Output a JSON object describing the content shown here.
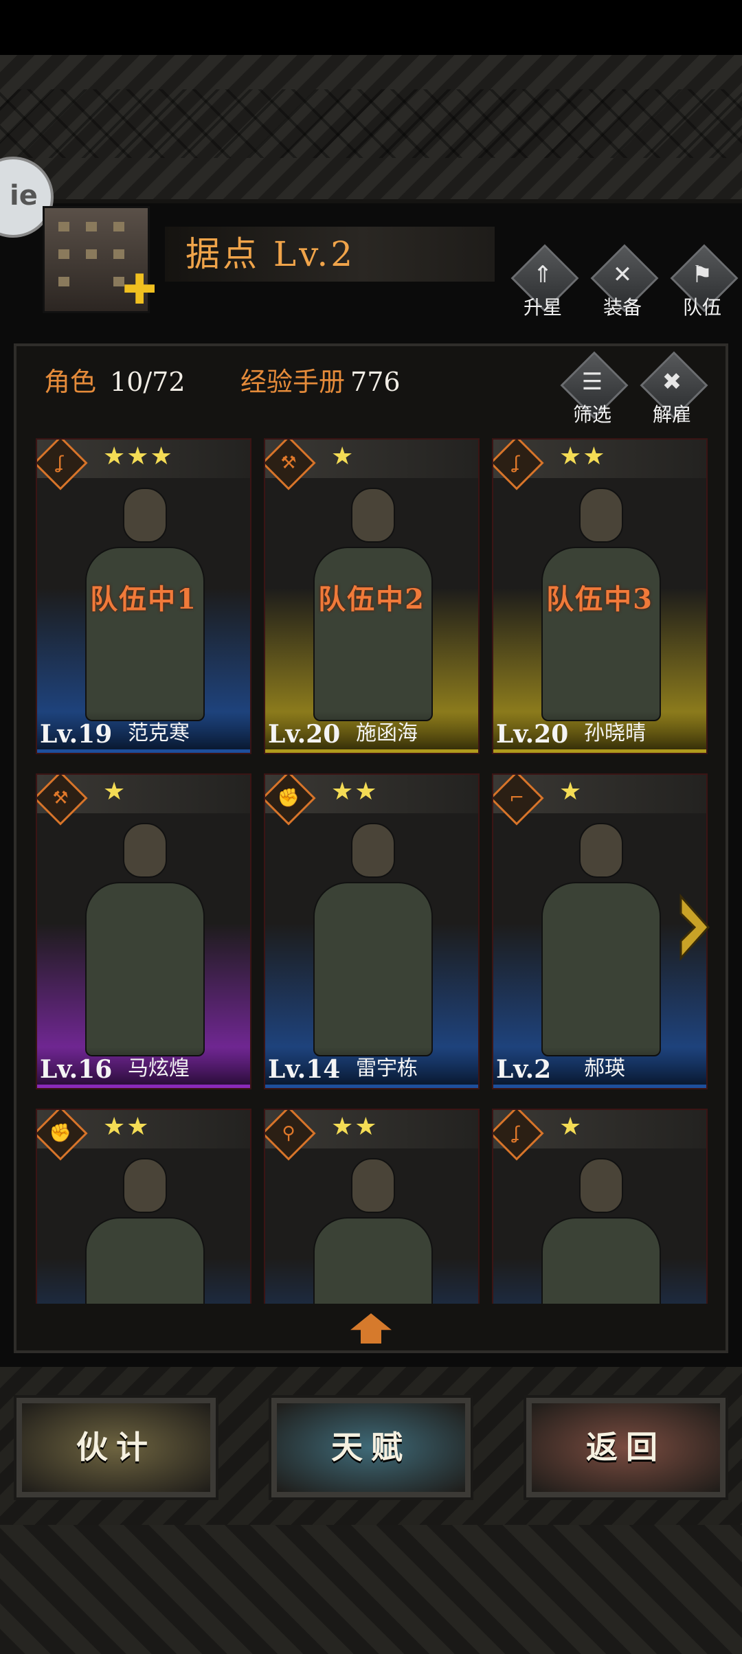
{
  "header": {
    "side_button_label": "ie",
    "title": "据点 Lv.2",
    "actions": [
      {
        "label": "升星",
        "icon": "upgrade-star-icon"
      },
      {
        "label": "装备",
        "icon": "equipment-tools-icon"
      },
      {
        "label": "队伍",
        "icon": "team-icon"
      }
    ]
  },
  "stats": {
    "characters_label": "角色",
    "characters_value": "10/72",
    "manual_label": "经验手册",
    "manual_value": "776"
  },
  "panel_actions": [
    {
      "label": "筛选",
      "icon": "filter-icon"
    },
    {
      "label": "解雇",
      "icon": "dismiss-icon"
    }
  ],
  "cards": [
    {
      "level": "Lv.19",
      "name": "范克寒",
      "stars": "★★★",
      "role_icon": "hook-icon",
      "tag": "队伍中1",
      "glow": "#1e4f9c"
    },
    {
      "level": "Lv.20",
      "name": "施函海",
      "stars": "★",
      "role_icon": "shovel-icon",
      "tag": "队伍中2",
      "glow": "#b09a1c"
    },
    {
      "level": "Lv.20",
      "name": "孙晓晴",
      "stars": "★★",
      "role_icon": "hook-icon",
      "tag": "队伍中3",
      "glow": "#b09a1c"
    },
    {
      "level": "Lv.16",
      "name": "马炫煌",
      "stars": "★",
      "role_icon": "shovel-icon",
      "tag": "",
      "glow": "#8a2ab8"
    },
    {
      "level": "Lv.14",
      "name": "雷宇栋",
      "stars": "★★",
      "role_icon": "fist-icon",
      "tag": "",
      "glow": "#1e4f9c"
    },
    {
      "level": "Lv.2",
      "name": "郝瑛",
      "stars": "★",
      "role_icon": "pistol-icon",
      "tag": "",
      "glow": "#1e4f9c"
    },
    {
      "level": "",
      "name": "",
      "stars": "★★",
      "role_icon": "fist-icon",
      "tag": "",
      "glow": "#1e4f9c"
    },
    {
      "level": "",
      "name": "",
      "stars": "★★",
      "role_icon": "magnifier-icon",
      "tag": "",
      "glow": "#1e4f9c"
    },
    {
      "level": "",
      "name": "",
      "stars": "★",
      "role_icon": "hook-icon",
      "tag": "",
      "glow": "#1e4f9c"
    }
  ],
  "bottom_buttons": [
    {
      "label": "伙计",
      "color": "#6e6440"
    },
    {
      "label": "天赋",
      "color": "#3f6a78"
    },
    {
      "label": "返回",
      "color": "#7a4c40"
    }
  ],
  "colors": {
    "accent": "#e58b3a",
    "tag": "#f07a3a",
    "star": "#f4dc55"
  }
}
